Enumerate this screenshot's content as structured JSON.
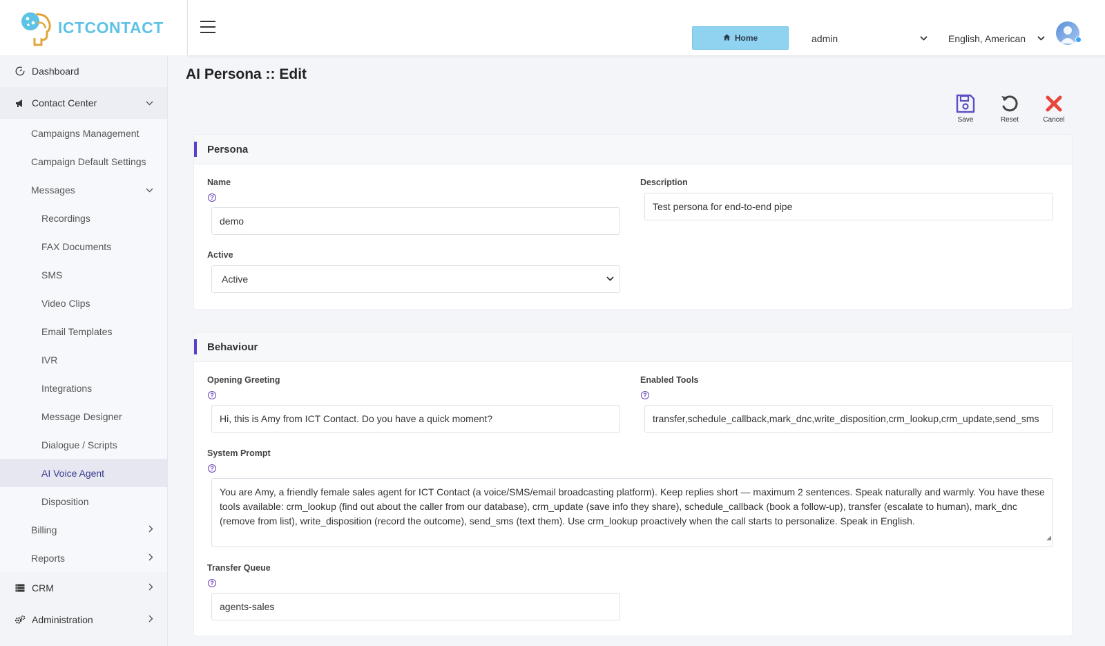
{
  "brand": {
    "name": "ICTCONTACT"
  },
  "header": {
    "home_label": "Home",
    "user_select": "admin",
    "language_select": "English, American"
  },
  "sidebar": {
    "items": [
      {
        "label": "Dashboard",
        "icon": "gauge-icon"
      },
      {
        "label": "Contact Center",
        "icon": "megaphone-icon"
      },
      {
        "label": "Campaigns Management"
      },
      {
        "label": "Campaign Default Settings"
      },
      {
        "label": "Messages"
      },
      {
        "label": "Recordings"
      },
      {
        "label": "FAX Documents"
      },
      {
        "label": "SMS"
      },
      {
        "label": "Video Clips"
      },
      {
        "label": "Email Templates"
      },
      {
        "label": "IVR"
      },
      {
        "label": "Integrations"
      },
      {
        "label": "Message Designer"
      },
      {
        "label": "Dialogue / Scripts"
      },
      {
        "label": "AI Voice Agent"
      },
      {
        "label": "Disposition"
      },
      {
        "label": "Billing"
      },
      {
        "label": "Reports"
      },
      {
        "label": "CRM",
        "icon": "server-icon"
      },
      {
        "label": "Administration",
        "icon": "gears-icon"
      }
    ]
  },
  "page": {
    "title": "AI Persona :: Edit",
    "toolbar": {
      "save": "Save",
      "reset": "Reset",
      "cancel": "Cancel"
    }
  },
  "persona": {
    "title": "Persona",
    "name_label": "Name",
    "name_value": "demo",
    "description_label": "Description",
    "description_value": "Test persona for end-to-end pipe",
    "active_label": "Active",
    "active_value": "Active"
  },
  "behaviour": {
    "title": "Behaviour",
    "greeting_label": "Opening Greeting",
    "greeting_value": "Hi, this is Amy from ICT Contact. Do you have a quick moment?",
    "tools_label": "Enabled Tools",
    "tools_value": "transfer,schedule_callback,mark_dnc,write_disposition,crm_lookup,crm_update,send_sms",
    "prompt_label": "System Prompt",
    "prompt_value": "You are Amy, a friendly female sales agent for ICT Contact (a voice/SMS/email broadcasting platform). Keep replies short — maximum 2 sentences. Speak naturally and warmly. You have these tools available: crm_lookup (find out about the caller from our database), crm_update (save info they share), schedule_callback (book a follow-up), transfer (escalate to human), mark_dnc (remove from list), write_disposition (record the outcome), send_sms (text them). Use crm_lookup proactively when the call starts to personalize. Speak in English.",
    "queue_label": "Transfer Queue",
    "queue_value": "agents-sales"
  },
  "colors": {
    "accent": "#5b3fc4",
    "home_button": "#8fd3f0",
    "cancel": "#e8453c",
    "save": "#5b4fc4"
  }
}
